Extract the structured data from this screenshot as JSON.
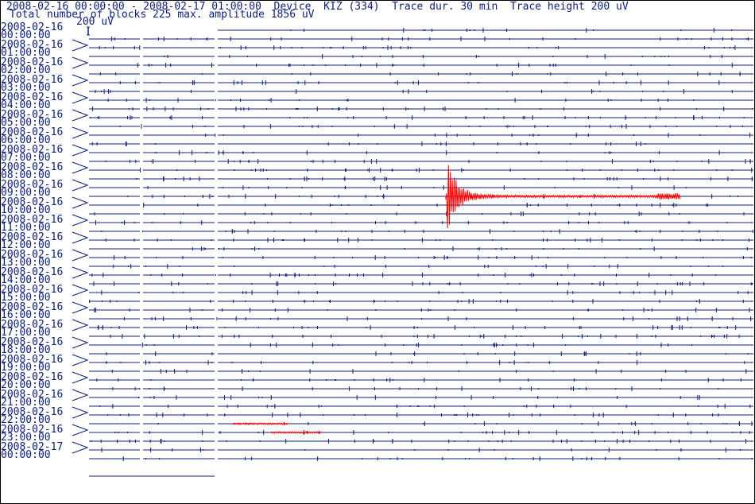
{
  "header": {
    "line1": "2008-02-16 00:00:00 - 2008-02-17 01:00:00  Device  KIZ (334)  Trace dur. 30 min  Trace height 200 uV",
    "line2": "Total number of blocks 225 max. amplitude 1856 uV",
    "scale_label": "200 uV"
  },
  "colors": {
    "trace": "#0b1e7a",
    "event": "#ff0000",
    "frame": "#000000"
  },
  "chart_data": {
    "type": "line",
    "title": "2008-02-16 00:00:00 - 2008-02-17 01:00:00  Device  KIZ (334)  Trace dur. 30 min  Trace height 200 uV",
    "device": "KIZ (334)",
    "trace_duration_min": 30,
    "trace_height_uV": 200,
    "total_blocks": 225,
    "max_amplitude_uV": 1856,
    "start": "2008-02-16 00:00:00",
    "end": "2008-02-17 01:00:00",
    "hour_labels": [
      {
        "date": "2008-02-16",
        "time": "00:00:00"
      },
      {
        "date": "2008-02-16",
        "time": "01:00:00"
      },
      {
        "date": "2008-02-16",
        "time": "02:00:00"
      },
      {
        "date": "2008-02-16",
        "time": "03:00:00"
      },
      {
        "date": "2008-02-16",
        "time": "04:00:00"
      },
      {
        "date": "2008-02-16",
        "time": "05:00:00"
      },
      {
        "date": "2008-02-16",
        "time": "06:00:00"
      },
      {
        "date": "2008-02-16",
        "time": "07:00:00"
      },
      {
        "date": "2008-02-16",
        "time": "08:00:00"
      },
      {
        "date": "2008-02-16",
        "time": "09:00:00"
      },
      {
        "date": "2008-02-16",
        "time": "10:00:00"
      },
      {
        "date": "2008-02-16",
        "time": "11:00:00"
      },
      {
        "date": "2008-02-16",
        "time": "12:00:00"
      },
      {
        "date": "2008-02-16",
        "time": "13:00:00"
      },
      {
        "date": "2008-02-16",
        "time": "14:00:00"
      },
      {
        "date": "2008-02-16",
        "time": "15:00:00"
      },
      {
        "date": "2008-02-16",
        "time": "16:00:00"
      },
      {
        "date": "2008-02-16",
        "time": "17:00:00"
      },
      {
        "date": "2008-02-16",
        "time": "18:00:00"
      },
      {
        "date": "2008-02-16",
        "time": "19:00:00"
      },
      {
        "date": "2008-02-16",
        "time": "20:00:00"
      },
      {
        "date": "2008-02-16",
        "time": "21:00:00"
      },
      {
        "date": "2008-02-16",
        "time": "22:00:00"
      },
      {
        "date": "2008-02-16",
        "time": "23:00:00"
      },
      {
        "date": "2008-02-17",
        "time": "00:00:00"
      }
    ],
    "traces": 50,
    "events": [
      {
        "start": "2008-02-16 09:30:00",
        "trace": 19,
        "onset_min": 16.1,
        "duration_min": 10.6,
        "peak_uV": 1856
      },
      {
        "start": "2008-02-16 22:30:00",
        "trace": 45,
        "onset_min": 6.5,
        "duration_min": 2.5,
        "peak_uV": 60
      },
      {
        "start": "2008-02-16 23:00:00",
        "trace": 46,
        "onset_min": 8.2,
        "duration_min": 2.3,
        "peak_uV": 20
      }
    ]
  }
}
